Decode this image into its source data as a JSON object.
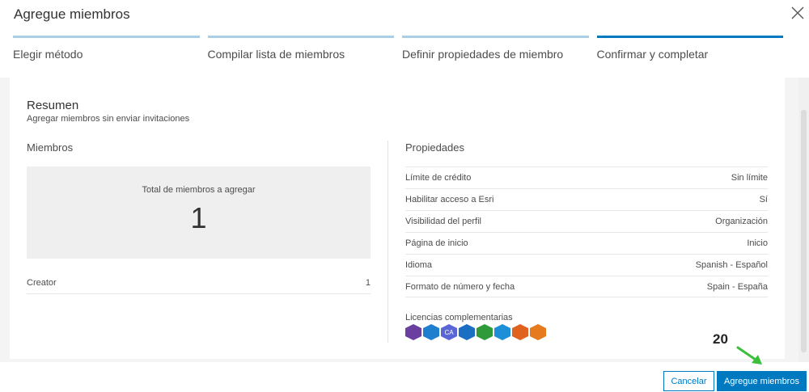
{
  "dialog": {
    "title": "Agregue miembros"
  },
  "steps": [
    {
      "label": "Elegir método"
    },
    {
      "label": "Compilar lista de miembros"
    },
    {
      "label": "Definir propiedades de miembro"
    },
    {
      "label": "Confirmar y completar"
    }
  ],
  "summary": {
    "title": "Resumen",
    "subtitle": "Agregar miembros sin enviar invitaciones"
  },
  "members": {
    "title": "Miembros",
    "total_label": "Total de miembros a agregar",
    "total_value": "1",
    "rows": [
      {
        "type": "Creator",
        "count": "1"
      }
    ]
  },
  "properties": {
    "title": "Propiedades",
    "rows": [
      {
        "label": "Límite de crédito",
        "value": "Sin límite"
      },
      {
        "label": "Habilitar acceso a Esri",
        "value": "Sí"
      },
      {
        "label": "Visibilidad del perfil",
        "value": "Organización"
      },
      {
        "label": "Página de inicio",
        "value": "Inicio"
      },
      {
        "label": "Idioma",
        "value": "Spanish - Español"
      },
      {
        "label": "Formato de número y fecha",
        "value": "Spain - España"
      }
    ],
    "licenses_label": "Licencias complementarias",
    "licenses": [
      {
        "icon": "compass-license-icon",
        "color": "#6b3fa0",
        "glyph": ""
      },
      {
        "icon": "pin-license-icon",
        "color": "#1f7fcf",
        "glyph": ""
      },
      {
        "icon": "ca-license-icon",
        "color": "#5a66d6",
        "glyph": "CA"
      },
      {
        "icon": "globe-license-icon",
        "color": "#1b6fc2",
        "glyph": ""
      },
      {
        "icon": "drone-license-icon",
        "color": "#2e9a3a",
        "glyph": ""
      },
      {
        "icon": "image-license-icon",
        "color": "#1d8fd6",
        "glyph": ""
      },
      {
        "icon": "forms-license-icon",
        "color": "#e0621f",
        "glyph": ""
      },
      {
        "icon": "navigator-license-icon",
        "color": "#e67a1e",
        "glyph": ""
      }
    ]
  },
  "footer": {
    "cancel_label": "Cancelar",
    "add_label": "Agregue miembros"
  },
  "annotation": {
    "badge": "20",
    "arrow_color": "#3bbf3b"
  }
}
